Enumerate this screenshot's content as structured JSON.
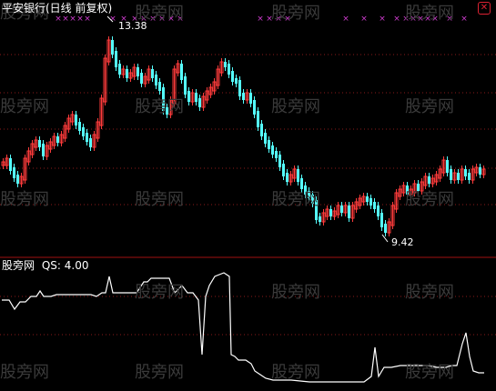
{
  "header": {
    "title": "平安银行(日线 前复权)",
    "close_glyph": "✕"
  },
  "indicator": {
    "name": "股旁网",
    "param_label": "QS:",
    "param_value": "4.00"
  },
  "annotations": {
    "high_label": "13.38",
    "low_label": "9.42"
  },
  "watermark": "股旁网",
  "colors": {
    "background": "#000000",
    "up": "#ff3b3b",
    "down": "#54ffff",
    "grid": "#8a1a1a",
    "separator": "#a01010",
    "marker": "#d03cd0",
    "line": "#ffffff"
  },
  "chart_data": {
    "type": "candlestick",
    "title": "平安银行(日线 前复权)",
    "price_high": 13.38,
    "price_low": 9.42,
    "indicator_series": {
      "name": "股旁网",
      "param": "QS: 4.00"
    }
  }
}
